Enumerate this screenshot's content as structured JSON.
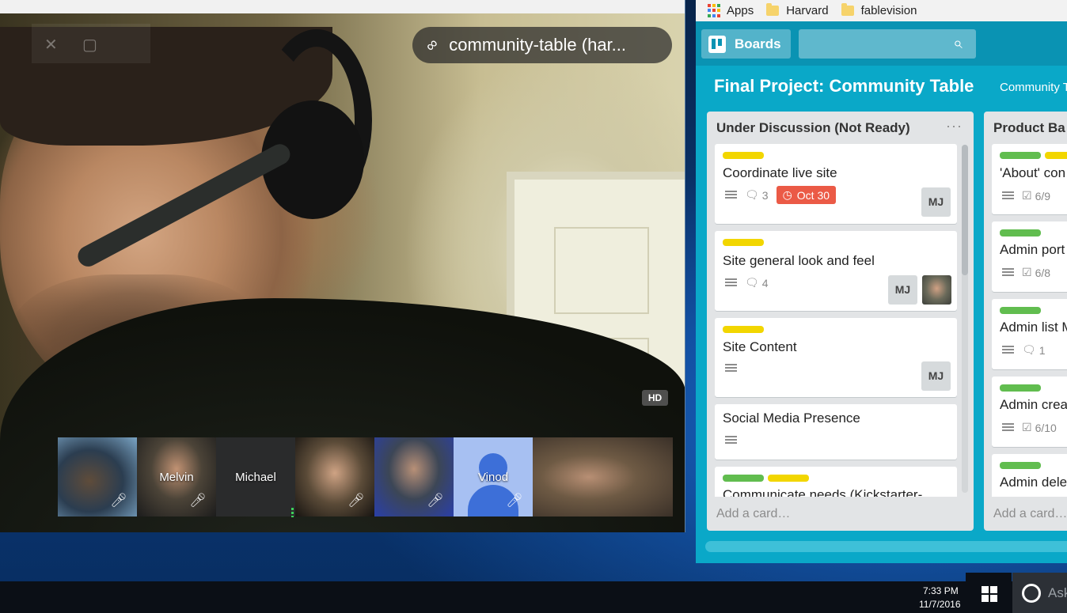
{
  "hangout": {
    "room_name": "community-table (har...",
    "hd_label": "HD",
    "participants": [
      {
        "name": ""
      },
      {
        "name": "Melvin"
      },
      {
        "name": "Michael"
      },
      {
        "name": ""
      },
      {
        "name": ""
      },
      {
        "name": "Vinod"
      },
      {
        "name": ""
      }
    ]
  },
  "browser": {
    "bookmarks": [
      {
        "label": "Apps",
        "icon": "apps-grid-icon"
      },
      {
        "label": "Harvard",
        "icon": "folder-icon"
      },
      {
        "label": "fablevision",
        "icon": "folder-icon"
      }
    ]
  },
  "trello": {
    "boards_label": "Boards",
    "search_value": "",
    "board_title": "Final Project: Community Table",
    "team_name": "Community T",
    "lists": [
      {
        "title": "Under Discussion (Not Ready)",
        "menu": "···",
        "add_card": "Add a card…",
        "cards": [
          {
            "title": "Coordinate live site",
            "comments": "3",
            "due": "Oct 30",
            "member": "MJ"
          },
          {
            "title": "Site general look and feel",
            "comments": "4",
            "member": "MJ"
          },
          {
            "title": "Site Content",
            "member": "MJ"
          },
          {
            "title": "Social Media Presence"
          },
          {
            "title": "Communicate needs (Kickstarter-"
          }
        ]
      },
      {
        "title": "Product Ba",
        "add_card": "Add a card…",
        "cards": [
          {
            "title": "'About' con",
            "checklist": "6/9"
          },
          {
            "title": "Admin port",
            "checklist": "6/8"
          },
          {
            "title": "Admin list M",
            "comments": "1"
          },
          {
            "title": "Admin crea",
            "checklist": "6/10"
          },
          {
            "title": "Admin dele"
          }
        ]
      }
    ]
  },
  "taskbar": {
    "time": "7:33 PM",
    "date": "11/7/2016",
    "cortana_text": "Ask"
  },
  "colors": {
    "trello_bg": "#0aa8c8",
    "label_yellow": "#f2d600",
    "label_green": "#61bd4f",
    "due_red": "#eb5a46",
    "speaking_green": "#3dd05a"
  }
}
